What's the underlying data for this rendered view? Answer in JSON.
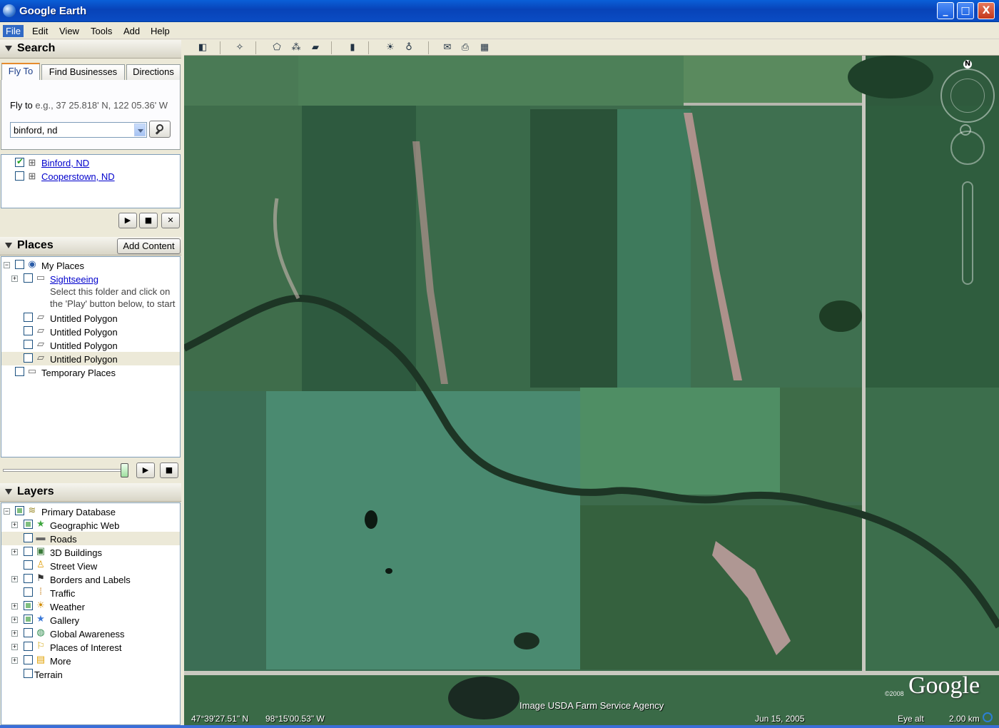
{
  "window": {
    "title": "Google Earth",
    "minimize": "_",
    "maximize": "□",
    "close": "X"
  },
  "menu": [
    "File",
    "Edit",
    "View",
    "Tools",
    "Add",
    "Help"
  ],
  "search": {
    "header": "Search",
    "tabs": [
      "Fly To",
      "Find Businesses",
      "Directions"
    ],
    "fly_to_label": "Fly to",
    "fly_to_hint": "e.g., 37 25.818' N, 122 05.36' W",
    "query": "binford, nd",
    "results": [
      {
        "label": "Binford, ND",
        "checked": true
      },
      {
        "label": "Cooperstown, ND",
        "checked": false
      }
    ]
  },
  "places": {
    "header": "Places",
    "add_content": "Add Content",
    "items": {
      "my_places": "My Places",
      "sightseeing": "Sightseeing",
      "sightseeing_hint_1": "Select this folder and click on",
      "sightseeing_hint_2": "the 'Play' button below, to start",
      "polygon_1": "Untitled Polygon",
      "polygon_2": "Untitled Polygon",
      "polygon_3": "Untitled Polygon",
      "polygon_4": "Untitled Polygon",
      "temporary": "Temporary Places"
    }
  },
  "layers": {
    "header": "Layers",
    "items": {
      "primary": "Primary Database",
      "geographic_web": "Geographic Web",
      "roads": "Roads",
      "buildings": "3D Buildings",
      "street_view": "Street View",
      "borders": "Borders and Labels",
      "traffic": "Traffic",
      "weather": "Weather",
      "gallery": "Gallery",
      "global_awareness": "Global Awareness",
      "poi": "Places of Interest",
      "more": "More",
      "terrain": "Terrain"
    }
  },
  "map": {
    "credit": "Image USDA Farm Service Agency",
    "latitude": "47°39'27.51\" N",
    "longitude": "98°15'00.53\" W",
    "date": "Jun 15, 2005",
    "eye_alt_label": "Eye alt",
    "eye_alt_value": "2.00 km",
    "logo": "Google",
    "copyright": "©2008",
    "compass_n": "N"
  }
}
